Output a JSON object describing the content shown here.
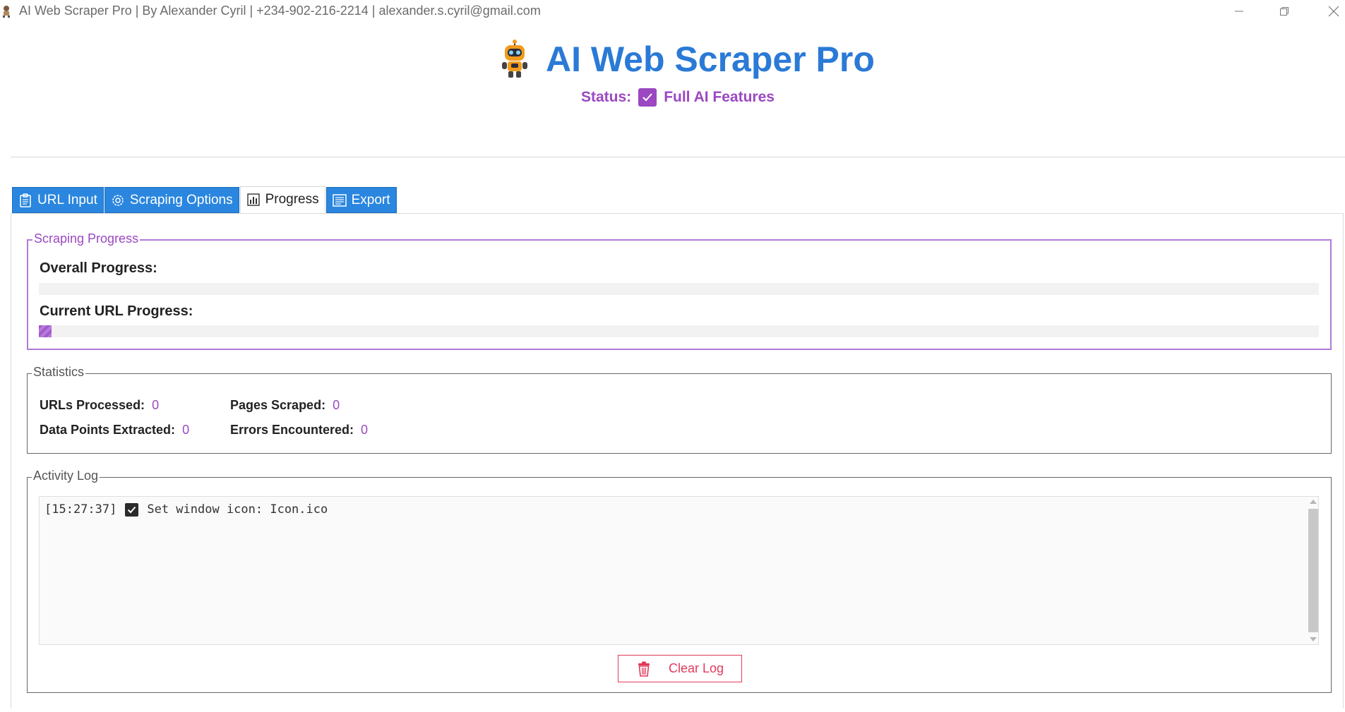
{
  "window": {
    "title": "AI Web Scraper Pro | By Alexander Cyril | +234-902-216-2214 | alexander.s.cyril@gmail.com",
    "controls": [
      "minimize-icon",
      "restore-icon",
      "close-icon"
    ]
  },
  "header": {
    "logo_icon": "robot-icon",
    "title": "AI Web Scraper Pro",
    "status_label": "Status:",
    "status_icon": "checkmark-icon",
    "status_value": "Full AI Features"
  },
  "tabs": [
    {
      "label": "URL Input",
      "icon": "clipboard-icon",
      "active": false
    },
    {
      "label": "Scraping Options",
      "icon": "gear-icon",
      "active": false
    },
    {
      "label": "Progress",
      "icon": "bar-chart-icon",
      "active": true
    },
    {
      "label": "Export",
      "icon": "document-icon",
      "active": false
    }
  ],
  "progress": {
    "group_title": "Scraping Progress",
    "overall_label": "Overall Progress:",
    "overall_value": 0,
    "current_label": "Current URL Progress:",
    "current_value": 0.01
  },
  "statistics": {
    "group_title": "Statistics",
    "items": [
      {
        "label": "URLs Processed:",
        "value": "0"
      },
      {
        "label": "Pages Scraped:",
        "value": "0"
      },
      {
        "label": "Data Points Extracted:",
        "value": "0"
      },
      {
        "label": "Errors Encountered:",
        "value": "0"
      }
    ]
  },
  "activity_log": {
    "group_title": "Activity Log",
    "entries": [
      {
        "time": "[15:27:37]",
        "icon": "checkbox-checked-icon",
        "message": "Set window icon: Icon.ico"
      }
    ],
    "clear_button": {
      "label": "Clear Log",
      "icon": "trash-icon"
    }
  },
  "colors": {
    "accent_blue": "#2a7ad6",
    "tab_blue": "#2a86de",
    "purple": "#9b48c2",
    "danger": "#e03a5a"
  }
}
